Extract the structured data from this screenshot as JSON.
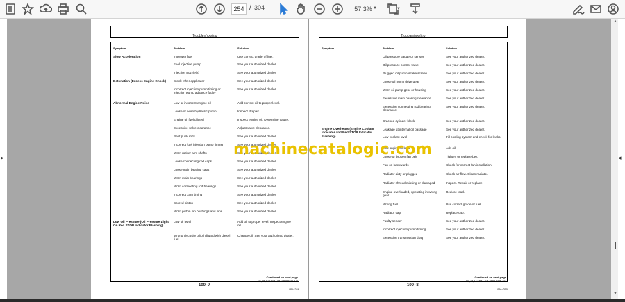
{
  "toolbar": {
    "page_current": "254",
    "page_sep": "/",
    "page_total": "304",
    "zoom": "57.3%",
    "icons": [
      "bookmark-icon",
      "star-icon",
      "upload-icon",
      "print-icon",
      "zoom-icon",
      "up-icon",
      "down-icon",
      "cursor-icon",
      "hand-icon",
      "minus-icon",
      "plus-icon",
      "page-fit-icon",
      "fit-height-icon",
      "sign-icon",
      "mail-icon",
      "account-icon"
    ]
  },
  "watermark": "machinecatalogic.com",
  "page1": {
    "header": "Troubleshooting",
    "col_symptom": "Symptom",
    "col_problem": "Problem",
    "col_solution": "Solution",
    "rows": [
      {
        "symptom": "Slow Acceleration",
        "problem": "Improper fuel",
        "solution": "Use correct grade of fuel."
      },
      {
        "symptom": "",
        "problem": "Fuel injection pump",
        "solution": "See your authorized dealer."
      },
      {
        "symptom": "",
        "problem": "Injection nozzle(s)",
        "solution": "See your authorized dealer."
      },
      {
        "symptom": "Detonation (Excess Engine Knock)",
        "problem": "Stock ether applicator",
        "solution": "See your authorized dealer."
      },
      {
        "symptom": "",
        "problem": "Incorrect injection pump timing or injection pump advance faulty",
        "solution": "See your authorized dealer."
      },
      {
        "symptom": "Abnormal Engine Noise",
        "problem": "Low or incorrect engine oil",
        "solution": "Add correct oil to proper level."
      },
      {
        "symptom": "",
        "problem": "Loose or worn hydraulic pump",
        "solution": "Inspect. Repair."
      },
      {
        "symptom": "",
        "problem": "Engine oil fuel diluted",
        "solution": "Inspect engine oil. Determine cause."
      },
      {
        "symptom": "",
        "problem": "Excessive valve clearance",
        "solution": "Adjust valve clearance."
      },
      {
        "symptom": "",
        "problem": "Bent push rods",
        "solution": "See your authorized dealer."
      },
      {
        "symptom": "",
        "problem": "Incorrect fuel injection pump timing",
        "solution": "See your authorized dealer."
      },
      {
        "symptom": "",
        "problem": "Worn rocker arm shafts",
        "solution": "See your authorized dealer."
      },
      {
        "symptom": "",
        "problem": "Loose connecting rod caps",
        "solution": "See your authorized dealer."
      },
      {
        "symptom": "",
        "problem": "Loose main bearing caps",
        "solution": "See your authorized dealer."
      },
      {
        "symptom": "",
        "problem": "Worn main bearings",
        "solution": "See your authorized dealer."
      },
      {
        "symptom": "",
        "problem": "Worn connecting rod bearings",
        "solution": "See your authorized dealer."
      },
      {
        "symptom": "",
        "problem": "Incorrect cam timing",
        "solution": "See your authorized dealer."
      },
      {
        "symptom": "",
        "problem": "Scored piston",
        "solution": "See your authorized dealer."
      },
      {
        "symptom": "",
        "problem": "Worn piston pin bushings and pins",
        "solution": "See your authorized dealer."
      },
      {
        "symptom": "Low Oil Pressure (Oil Pressure Light On Red STOP Indicator Flashing)",
        "problem": "Low oil level",
        "solution": "Add oil to proper level. Inspect engine oil."
      },
      {
        "symptom": "",
        "problem": "Wrong viscosity oil/oil diluted with diesel fuel",
        "solution": "Change oil. See your authorized dealer."
      }
    ],
    "continued": "Continued on next page",
    "code": "TS,78,17736B -19-29NOV06-1/2",
    "page_number": "100–7",
    "ref": "PN=249"
  },
  "page2": {
    "header": "Troubleshooting",
    "col_symptom": "Symptom",
    "col_problem": "Problem",
    "col_solution": "Solution",
    "rows": [
      {
        "symptom": "",
        "problem": "Oil pressure gauge or sensor",
        "solution": "See your authorized dealer."
      },
      {
        "symptom": "",
        "problem": "Oil pressure control valve",
        "solution": "See your authorized dealer."
      },
      {
        "symptom": "",
        "problem": "Plugged oil pump intake screen",
        "solution": "See your authorized dealer."
      },
      {
        "symptom": "",
        "problem": "Loose oil pump drive gear",
        "solution": "See your authorized dealer."
      },
      {
        "symptom": "",
        "problem": "Worn oil pump gear or housing",
        "solution": "See your authorized dealer."
      },
      {
        "symptom": "",
        "problem": "Excessive main bearing clearance",
        "solution": "See your authorized dealer."
      },
      {
        "symptom": "",
        "problem": "Excessive connecting rod bearing clearance",
        "solution": "See your authorized dealer."
      },
      {
        "symptom": "",
        "problem": "Cracked cylinder block",
        "solution": "See your authorized dealer."
      },
      {
        "symptom": "",
        "problem": "Leakage at internal oil passage",
        "solution": "See your authorized dealer."
      },
      {
        "symptom": "Engine Overheats (Engine Coolant Indicator and Red STOP Indicator Flashing)",
        "problem": "Low coolant level",
        "solution": "Fill cooling system and check for leaks."
      },
      {
        "symptom": "",
        "problem": "Low engine oil level",
        "solution": "Add oil."
      },
      {
        "symptom": "",
        "problem": "Loose or broken fan belt",
        "solution": "Tighten or replace belt."
      },
      {
        "symptom": "",
        "problem": "Fan on backwards",
        "solution": "Check for correct fan installation."
      },
      {
        "symptom": "",
        "problem": "Radiator dirty or plugged",
        "solution": "Check air flow. Clean radiator."
      },
      {
        "symptom": "",
        "problem": "Radiator shroud missing or damaged",
        "solution": "Inspect. Repair or replace."
      },
      {
        "symptom": "",
        "problem": "Engine overloaded, operating in wrong gear",
        "solution": "Reduce load."
      },
      {
        "symptom": "",
        "problem": "Wrong fuel",
        "solution": "Use correct grade of fuel."
      },
      {
        "symptom": "",
        "problem": "Radiator cap",
        "solution": "Replace cap."
      },
      {
        "symptom": "",
        "problem": "Faulty sender",
        "solution": "See your authorized dealer."
      },
      {
        "symptom": "",
        "problem": "Incorrect injection pump timing",
        "solution": "See your authorized dealer."
      },
      {
        "symptom": "",
        "problem": "Excessive transmission drag",
        "solution": "See your authorized dealer."
      }
    ],
    "continued": "Continued on next page",
    "code": "TS,78,17736C -19-29NOV06-2/2",
    "page_number": "100–8",
    "ref": "PN=250"
  }
}
